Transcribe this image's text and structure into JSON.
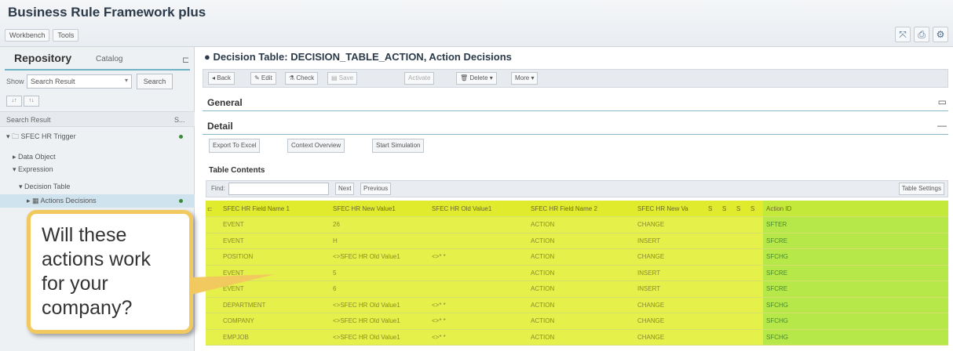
{
  "app": {
    "title": "Business Rule Framework plus",
    "menu": [
      "Workbench",
      "Tools"
    ],
    "top_icons": [
      "fullscreen-icon",
      "print-icon",
      "help-icon"
    ]
  },
  "repository": {
    "title": "Repository",
    "catalog_tab": "Catalog",
    "show_label": "Show",
    "show_value": "Search Result",
    "search_button": "Search",
    "sort_buttons": [
      "↓↑",
      "↑↓"
    ],
    "result_header": "Search Result",
    "result_col": "S...",
    "tree": [
      {
        "label": "SFEC HR Trigger",
        "prefix": "▾ 🗀"
      },
      {
        "label": "Data Object",
        "prefix": "▸"
      },
      {
        "label": "Expression",
        "prefix": "▾"
      },
      {
        "label": "Decision Table",
        "prefix": "▾"
      },
      {
        "label": "Actions Decisions",
        "prefix": "▸ ▦"
      }
    ]
  },
  "callout": {
    "text": "Will these actions work for your company?"
  },
  "main": {
    "title": "Decision Table: DECISION_TABLE_ACTION, Action Decisions",
    "toolbar": {
      "back": "◂ Back",
      "edit": "✎ Edit",
      "check": "Check",
      "save": "Save",
      "activate": "Activate",
      "delete": "Delete",
      "more": "More"
    },
    "general_label": "General",
    "detail_label": "Detail",
    "detail_buttons": [
      "Export To Excel",
      "Context Overview",
      "Start Simulation"
    ],
    "table_contents_label": "Table Contents",
    "find_label": "Find:",
    "next_button": "Next",
    "previous_button": "Previous",
    "table_settings_button": "Table Settings"
  },
  "table": {
    "columns": [
      "SFEC HR Field Name 1",
      "SFEC HR New Value1",
      "SFEC HR Old Value1",
      "SFEC HR Field Name 2",
      "SFEC HR New Va",
      "S",
      "S",
      "S",
      "S",
      "Action ID"
    ],
    "rows": [
      [
        "EVENT",
        "26",
        "",
        "ACTION",
        "CHANGE",
        "",
        "",
        "",
        "",
        "SFTER"
      ],
      [
        "EVENT",
        "H",
        "",
        "ACTION",
        "INSERT",
        "",
        "",
        "",
        "",
        "SFCRE"
      ],
      [
        "POSITION",
        "<>SFEC HR Old Value1",
        "<>* *",
        "ACTION",
        "CHANGE",
        "",
        "",
        "",
        "",
        "SFCHG"
      ],
      [
        "EVENT",
        "5",
        "",
        "ACTION",
        "INSERT",
        "",
        "",
        "",
        "",
        "SFCRE"
      ],
      [
        "EVENT",
        "6",
        "",
        "ACTION",
        "INSERT",
        "",
        "",
        "",
        "",
        "SFCRE"
      ],
      [
        "DEPARTMENT",
        "<>SFEC HR Old Value1",
        "<>* *",
        "ACTION",
        "CHANGE",
        "",
        "",
        "",
        "",
        "SFCHG"
      ],
      [
        "COMPANY",
        "<>SFEC HR Old Value1",
        "<>* *",
        "ACTION",
        "CHANGE",
        "",
        "",
        "",
        "",
        "SFCHG"
      ],
      [
        "EMPJOB",
        "<>SFEC HR Old Value1",
        "<>* *",
        "ACTION",
        "CHANGE",
        "",
        "",
        "",
        "",
        "SFCHG"
      ]
    ]
  },
  "colors": {
    "row_yellow": "#e6f04a",
    "action_green": "#b7e84a",
    "callout_border": "#f2c95e",
    "accent": "#6fb3c4"
  }
}
